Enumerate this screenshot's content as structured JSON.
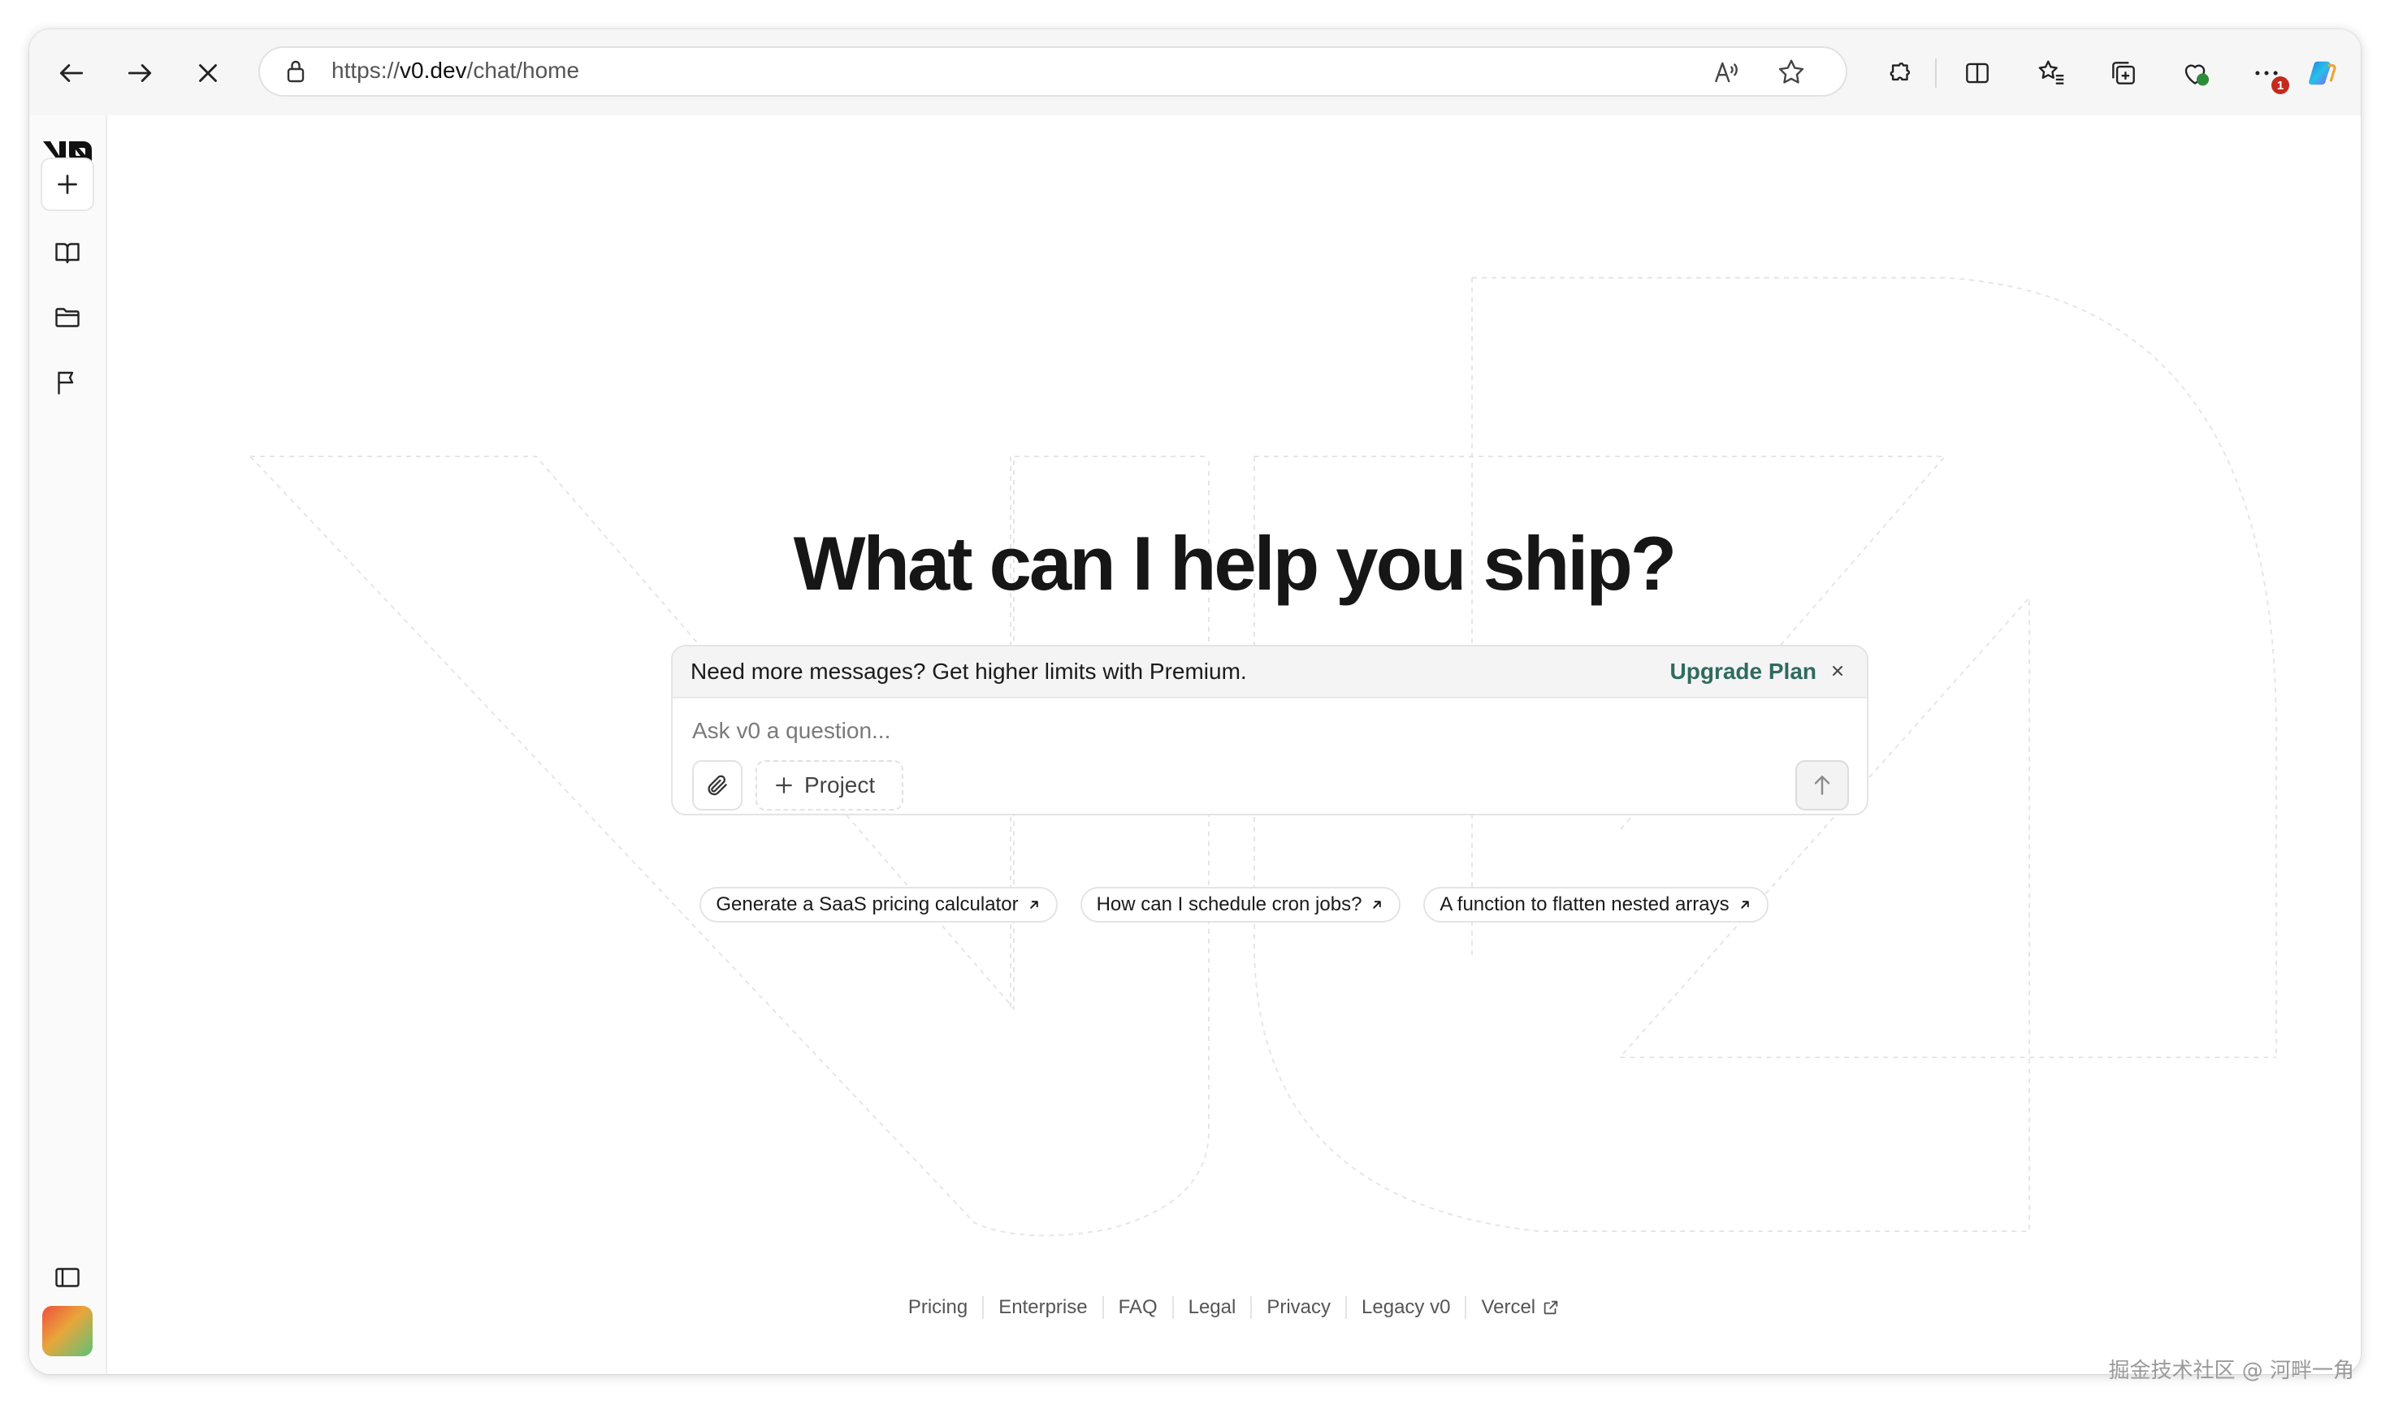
{
  "browser": {
    "url_scheme": "https://",
    "url_host": "v0.dev",
    "url_path": "/chat/home",
    "notification_badge": "1"
  },
  "sidebar": {
    "items": [
      {
        "name": "new-chat",
        "icon": "plus-icon"
      },
      {
        "name": "library",
        "icon": "book-icon"
      },
      {
        "name": "projects",
        "icon": "folder-icon"
      },
      {
        "name": "feedback",
        "icon": "flag-icon"
      }
    ],
    "toggle_icon": "sidebar-toggle-icon"
  },
  "hero": {
    "title": "What can I help you ship?"
  },
  "banner": {
    "text": "Need more messages? Get higher limits with Premium.",
    "upgrade_label": "Upgrade Plan",
    "close_glyph": "×"
  },
  "composer": {
    "placeholder": "Ask v0 a question...",
    "value": "",
    "project_label": "Project"
  },
  "suggestions": [
    "Generate a SaaS pricing calculator",
    "How can I schedule cron jobs?",
    "A function to flatten nested arrays"
  ],
  "footer": {
    "links": [
      "Pricing",
      "Enterprise",
      "FAQ",
      "Legal",
      "Privacy",
      "Legacy v0",
      "Vercel"
    ]
  },
  "watermark": "掘金技术社区 @ 河畔一角",
  "colors": {
    "accent_green": "#2f6b5e",
    "title": "#161616",
    "border": "#e4e4e6"
  }
}
